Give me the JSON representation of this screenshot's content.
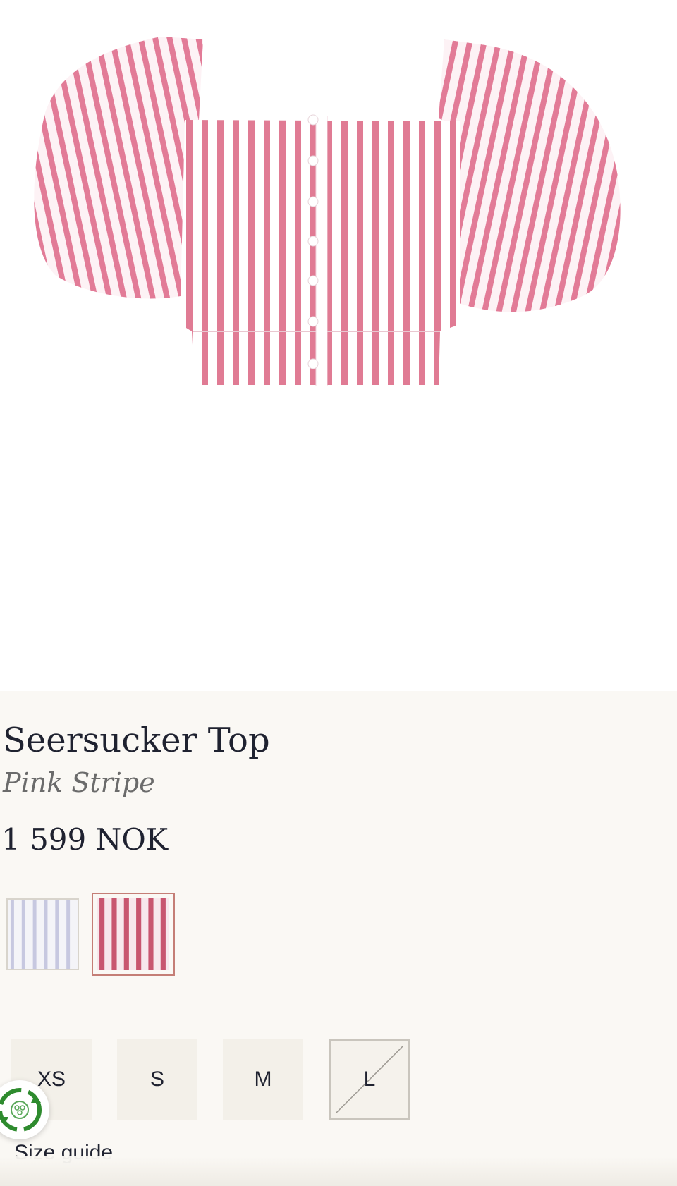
{
  "product": {
    "image_alt": "Pink and white striped seersucker top with puff sleeves",
    "title": "Seersucker Top",
    "color": "Pink Stripe",
    "price": "1 599 NOK"
  },
  "swatches": [
    {
      "name": "White/Blue Stripe",
      "stripe_color": "#b8b9d8",
      "selected": false
    },
    {
      "name": "Pink Stripe",
      "stripe_color": "#c8566f",
      "selected": true
    }
  ],
  "sizes": [
    {
      "label": "XS",
      "available": true
    },
    {
      "label": "S",
      "available": true
    },
    {
      "label": "M",
      "available": true
    },
    {
      "label": "L",
      "available": false
    }
  ],
  "size_guide": {
    "label": "Size guide"
  },
  "colors": {
    "background": "#faf8f4",
    "text": "#1f2230",
    "accent_border": "#c47e76",
    "size_bg": "#f3f0e9",
    "stripe_pink": "#e07b94",
    "eco_green": "#2e8b2e"
  },
  "icons": {
    "eco": "recycle-leaf-icon"
  }
}
